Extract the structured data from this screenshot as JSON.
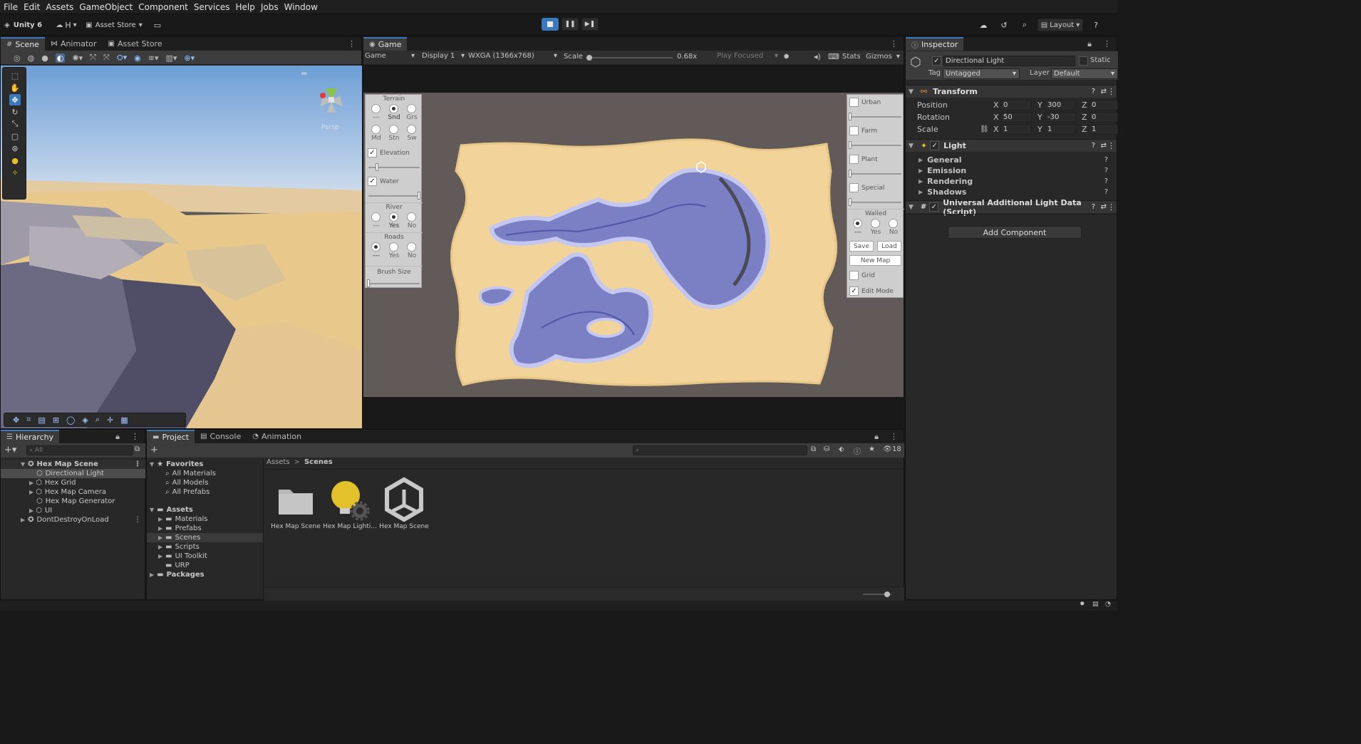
{
  "menu": [
    "File",
    "Edit",
    "Assets",
    "GameObject",
    "Component",
    "Services",
    "Help",
    "Jobs",
    "Window"
  ],
  "toolbar": {
    "account": "Unity 6",
    "user_initial": "H",
    "asset_store": "Asset Store",
    "layout": "Layout"
  },
  "scene_panel": {
    "tabs": [
      "Scene",
      "Animator",
      "Asset Store"
    ],
    "persp_label": "Persp"
  },
  "game_panel": {
    "tab": "Game",
    "mode": "Game",
    "display": "Display 1",
    "resolution": "WXGA (1366x768)",
    "scale_label": "Scale",
    "scale_value": "0.68x",
    "play_focused": "Play Focused",
    "stats": "Stats",
    "gizmos": "Gizmos",
    "left_ui": {
      "terrain_title": "Terrain",
      "terrain_options": [
        "---",
        "Snd",
        "Grs",
        "Md",
        "Stn",
        "Sw"
      ],
      "terrain_selected": 1,
      "elevation_label": "Elevation",
      "elevation_checked": true,
      "water_label": "Water",
      "water_checked": true,
      "river_title": "River",
      "river_options": [
        "---",
        "Yes",
        "No"
      ],
      "river_selected": 1,
      "roads_title": "Roads",
      "roads_options": [
        "---",
        "Yes",
        "No"
      ],
      "roads_selected": 0,
      "brush_size": "Brush Size"
    },
    "right_ui": {
      "urban": "Urban",
      "farm": "Farm",
      "plant": "Plant",
      "special": "Special",
      "walled_title": "Walled",
      "walled_options": [
        "---",
        "Yes",
        "No"
      ],
      "walled_selected": 0,
      "save": "Save",
      "load": "Load",
      "new_map": "New Map",
      "grid": "Grid",
      "edit_mode": "Edit Mode",
      "edit_mode_checked": true
    }
  },
  "inspector": {
    "tab": "Inspector",
    "object_name": "Directional Light",
    "static_label": "Static",
    "tag_label": "Tag",
    "tag_value": "Untagged",
    "layer_label": "Layer",
    "layer_value": "Default",
    "transform": {
      "title": "Transform",
      "position_label": "Position",
      "rotation_label": "Rotation",
      "scale_label": "Scale",
      "position": {
        "x": "0",
        "y": "300",
        "z": "0"
      },
      "rotation": {
        "x": "50",
        "y": "-30",
        "z": "0"
      },
      "scale": {
        "x": "1",
        "y": "1",
        "z": "1"
      }
    },
    "light": {
      "title": "Light",
      "sections": [
        "General",
        "Emission",
        "Rendering",
        "Shadows"
      ]
    },
    "urp_component": "Universal Additional Light Data (Script)",
    "add_component": "Add Component"
  },
  "hierarchy": {
    "tab": "Hierarchy",
    "search_placeholder": "All",
    "items": [
      {
        "label": "Hex Map Scene",
        "depth": 0,
        "type": "scene"
      },
      {
        "label": "Directional Light",
        "depth": 1,
        "type": "object"
      },
      {
        "label": "Hex Grid",
        "depth": 1,
        "type": "object"
      },
      {
        "label": "Hex Map Camera",
        "depth": 1,
        "type": "object"
      },
      {
        "label": "Hex Map Generator",
        "depth": 1,
        "type": "object"
      },
      {
        "label": "UI",
        "depth": 1,
        "type": "object"
      },
      {
        "label": "DontDestroyOnLoad",
        "depth": 0,
        "type": "scene"
      }
    ]
  },
  "project": {
    "tabs": [
      "Project",
      "Console",
      "Animation"
    ],
    "hidden_count": "18",
    "favorites_title": "Favorites",
    "favorites": [
      "All Materials",
      "All Models",
      "All Prefabs"
    ],
    "assets_title": "Assets",
    "asset_folders": [
      "Materials",
      "Prefabs",
      "Scenes",
      "Scripts",
      "UI Toolkit",
      "URP"
    ],
    "packages_title": "Packages",
    "breadcrumb": [
      "Assets",
      "Scenes"
    ],
    "files": [
      "Hex Map Scene",
      "Hex Map Lighti...",
      "Hex Map Scene"
    ]
  },
  "colors": {
    "accent": "#3a79bb",
    "sand": "#f2d49a",
    "water": "#7b7fc4"
  }
}
